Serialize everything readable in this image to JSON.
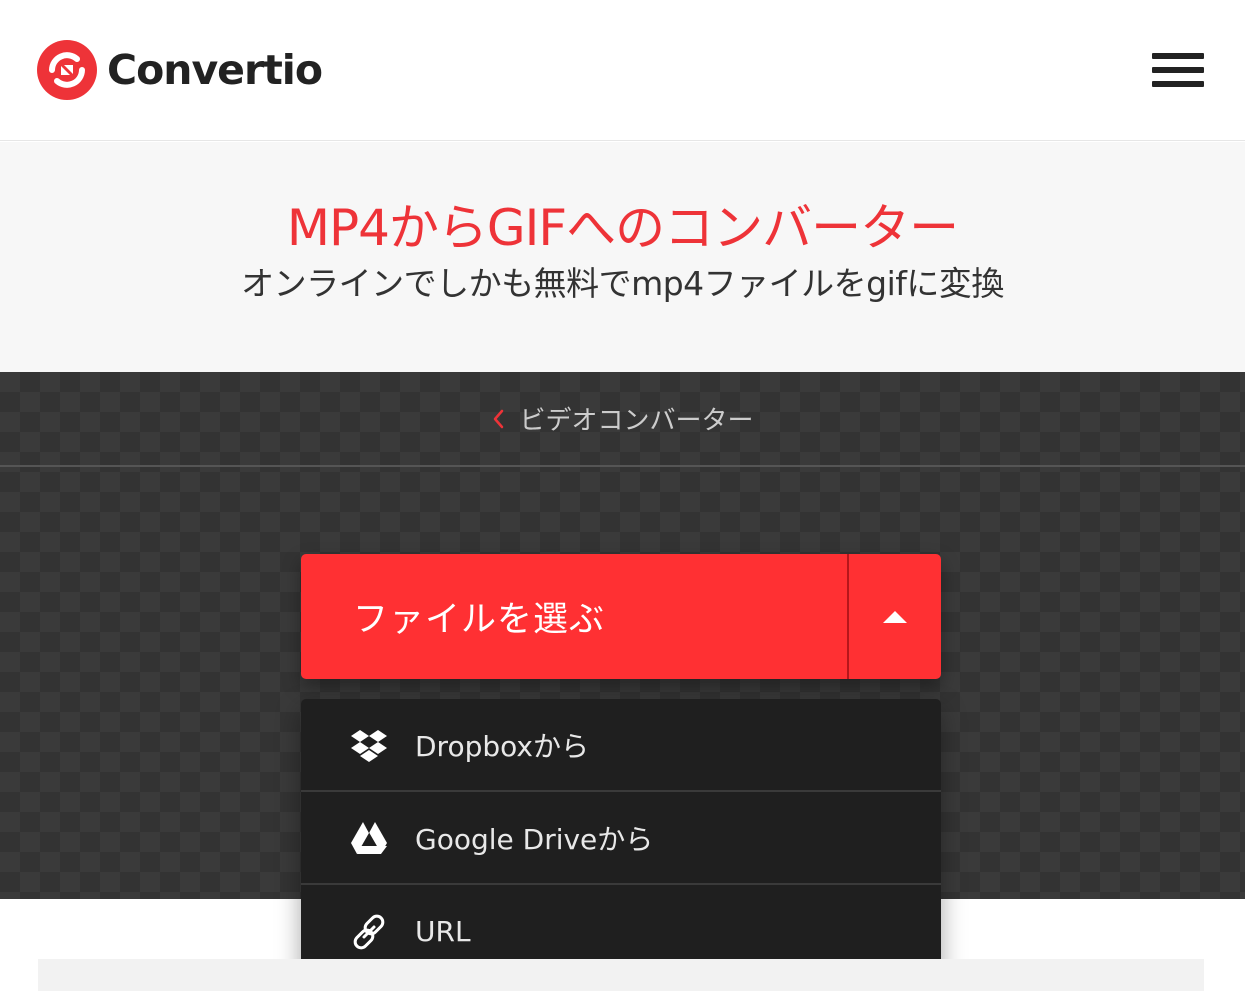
{
  "header": {
    "logo_text": "Convertio",
    "brand_color": "#ee3338",
    "menu_icon": "hamburger-menu-icon"
  },
  "hero": {
    "title": "MP4からGIFへのコンバーター",
    "subtitle": "オンラインでしかも無料でmp4ファイルをgifに変換"
  },
  "breadcrumb": {
    "icon": "chevron-left-icon",
    "label": "ビデオコンバーター"
  },
  "upload": {
    "button_label": "ファイルを選ぶ",
    "toggle_icon": "caret-up-icon",
    "button_color": "#ff3033",
    "sources": [
      {
        "icon": "dropbox-icon",
        "label": "Dropboxから"
      },
      {
        "icon": "google-drive-icon",
        "label": "Google Driveから"
      },
      {
        "icon": "link-icon",
        "label": "URL"
      }
    ]
  }
}
